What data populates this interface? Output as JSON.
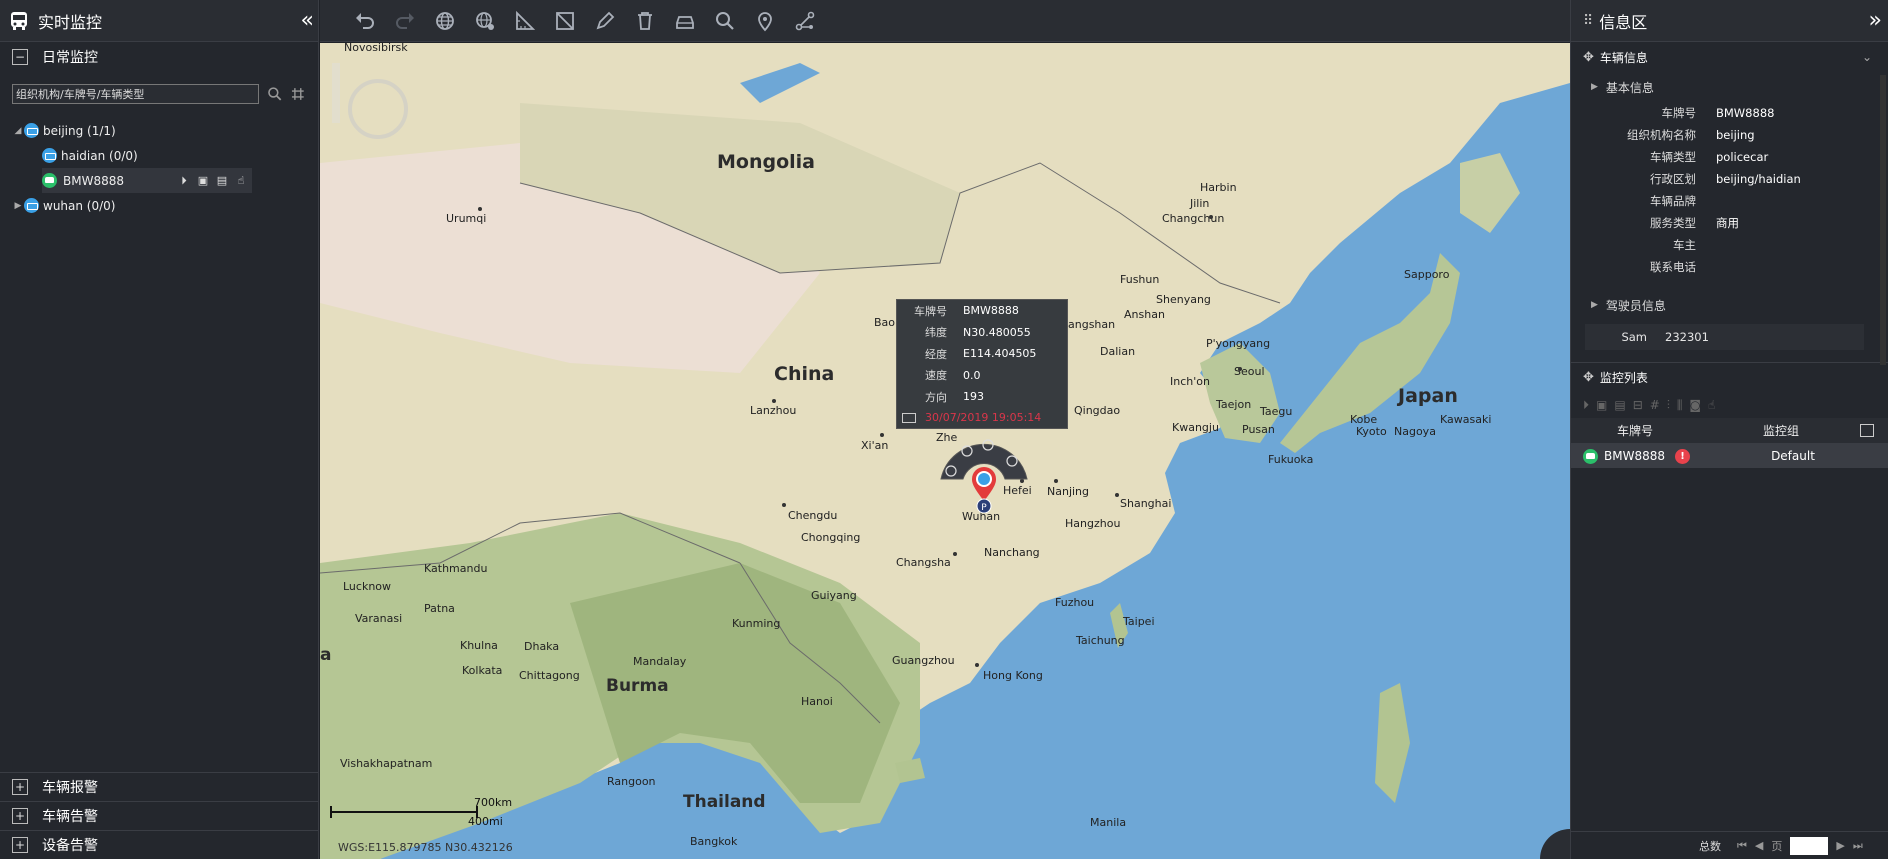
{
  "left": {
    "title": "实时监控",
    "daily": "日常监控",
    "search_placeholder": "组织机构/车牌号/车辆类型",
    "tree": {
      "beijing": "beijing (1/1)",
      "haidian": "haidian (0/0)",
      "vehicle": "BMW8888",
      "wuhan": "wuhan (0/0)"
    },
    "bottom": [
      "车辆报警",
      "车辆告警",
      "设备告警"
    ]
  },
  "map": {
    "labels": {
      "novosibirsk": "Novosibirsk",
      "mongolia": "Mongolia",
      "urumqi": "Urumqi",
      "harbin": "Harbin",
      "jilin": "Jilin",
      "changchun": "Changchun",
      "fushun": "Fushun",
      "shenyang": "Shenyang",
      "anshan": "Anshan",
      "dalian": "Dalian",
      "pyongyang": "P'yongyang",
      "seoul": "Seoul",
      "incheon": "Inch'on",
      "taejon": "Taejon",
      "taegu": "Taegu",
      "kwangju": "Kwangju",
      "pusan": "Pusan",
      "sapporo": "Sapporo",
      "japan": "Japan",
      "kobe": "Kobe",
      "kyoto": "Kyoto",
      "nagoya": "Nagoya",
      "kawasaki": "Kawasaki",
      "fukuoka": "Fukuoka",
      "china": "China",
      "lanzhou": "Lanzhou",
      "xian": "Xi'an",
      "zhe": "Zhe",
      "bao": "Bao",
      "tangshan": "angshan",
      "qingdao": "Qingdao",
      "hefei": "Hefei",
      "nanjing": "Nanjing",
      "shanghai": "Shanghai",
      "wuhan": "Wuhan",
      "hangzhou": "Hangzhou",
      "chengdu": "Chengdu",
      "chongqing": "Chongqing",
      "changsha": "Changsha",
      "nanchang": "Nanchang",
      "fuzhou": "Fuzhou",
      "taipei": "Taipei",
      "taichung": "Taichung",
      "guiyang": "Guiyang",
      "kunming": "Kunming",
      "guangzhou": "Guangzhou",
      "hongkong": "Hong Kong",
      "kathmandu": "Kathmandu",
      "lucknow": "Lucknow",
      "varanasi": "Varanasi",
      "patna": "Patna",
      "khulna": "Khulna",
      "dhaka": "Dhaka",
      "kolkata": "Kolkata",
      "chittagong": "Chittagong",
      "mandalay": "Mandalay",
      "burma": "Burma",
      "hanoi": "Hanoi",
      "rangoon": "Rangoon",
      "thailand": "Thailand",
      "vishakhapatnam": "Vishakhapatnam",
      "bangkok": "Bangkok",
      "manila": "Manila",
      "ia": "a"
    },
    "popup": {
      "rows": [
        {
          "k": "车牌号",
          "v": "BMW8888"
        },
        {
          "k": "纬度",
          "v": "N30.480055"
        },
        {
          "k": "经度",
          "v": "E114.404505"
        },
        {
          "k": "速度",
          "v": "0.0"
        },
        {
          "k": "方向",
          "v": "193"
        }
      ],
      "time": "30/07/2019 19:05:14"
    },
    "scale_km": "700km",
    "scale_mi": "400mi",
    "coords": "WGS:E115.879785  N30.432126"
  },
  "right": {
    "title": "信息区",
    "vehicle_info": "车辆信息",
    "basic_info": "基本信息",
    "fields": [
      {
        "k": "车牌号",
        "v": "BMW8888"
      },
      {
        "k": "组织机构名称",
        "v": "beijing"
      },
      {
        "k": "车辆类型",
        "v": "policecar"
      },
      {
        "k": "行政区划",
        "v": "beijing/haidian"
      },
      {
        "k": "车辆品牌",
        "v": ""
      },
      {
        "k": "服务类型",
        "v": "商用"
      },
      {
        "k": "车主",
        "v": ""
      },
      {
        "k": "联系电话",
        "v": ""
      }
    ],
    "driver_info": "驾驶员信息",
    "driver": {
      "k": "Sam",
      "v": "232301"
    },
    "monitor_list": "监控列表",
    "col_plate": "车牌号",
    "col_group": "监控组",
    "row_plate": "BMW8888",
    "row_group": "Default",
    "total": "总数",
    "page": "页"
  },
  "colors": {
    "panel": "#24272d",
    "water": "#6ea7d6",
    "land": "#e8e2c6",
    "accent_red": "#d9364a",
    "vehicle_green": "#2bbf6a",
    "org_blue": "#3aa0e6"
  }
}
